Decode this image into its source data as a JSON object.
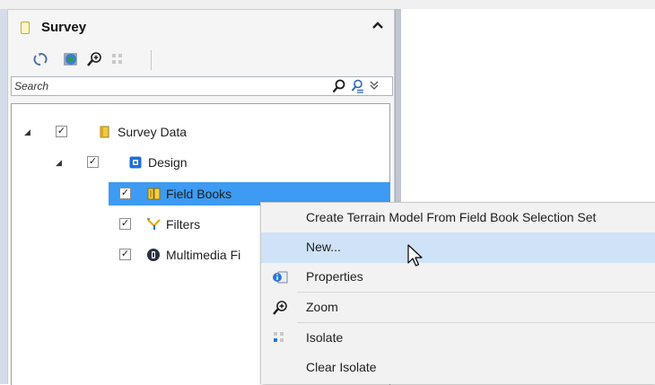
{
  "panel": {
    "title": "Survey",
    "collapse_icon": "chevron-up-icon"
  },
  "toolbar": {
    "buttons": [
      "refresh-icon",
      "globe-icon",
      "zoom-icon",
      "isolate-icon"
    ]
  },
  "search": {
    "placeholder": "Search",
    "value": ""
  },
  "tree": {
    "items": [
      {
        "label": "Survey Data",
        "checked": true,
        "expanded": true,
        "icon": "survey-data-icon"
      },
      {
        "label": "Design",
        "checked": true,
        "expanded": true,
        "icon": "design-icon"
      },
      {
        "label": "Field Books",
        "checked": true,
        "selected": true,
        "icon": "field-books-icon"
      },
      {
        "label": "Filters",
        "checked": true,
        "icon": "filters-icon"
      },
      {
        "label": "Multimedia Fi",
        "checked": true,
        "icon": "multimedia-icon"
      }
    ]
  },
  "context_menu": {
    "items": [
      {
        "label": "Create Terrain Model From Field Book Selection Set"
      },
      {
        "label": "New...",
        "hovered": true
      },
      {
        "label": "Properties",
        "icon": "properties-icon"
      },
      {
        "label": "Zoom",
        "icon": "zoom-icon"
      },
      {
        "label": "Isolate",
        "icon": "isolate-icon"
      },
      {
        "label": "Clear Isolate"
      }
    ]
  },
  "colors": {
    "selection": "#3d9bf3",
    "menu_hover": "#cfe2f7",
    "menu_background": "#f2f2f2"
  }
}
